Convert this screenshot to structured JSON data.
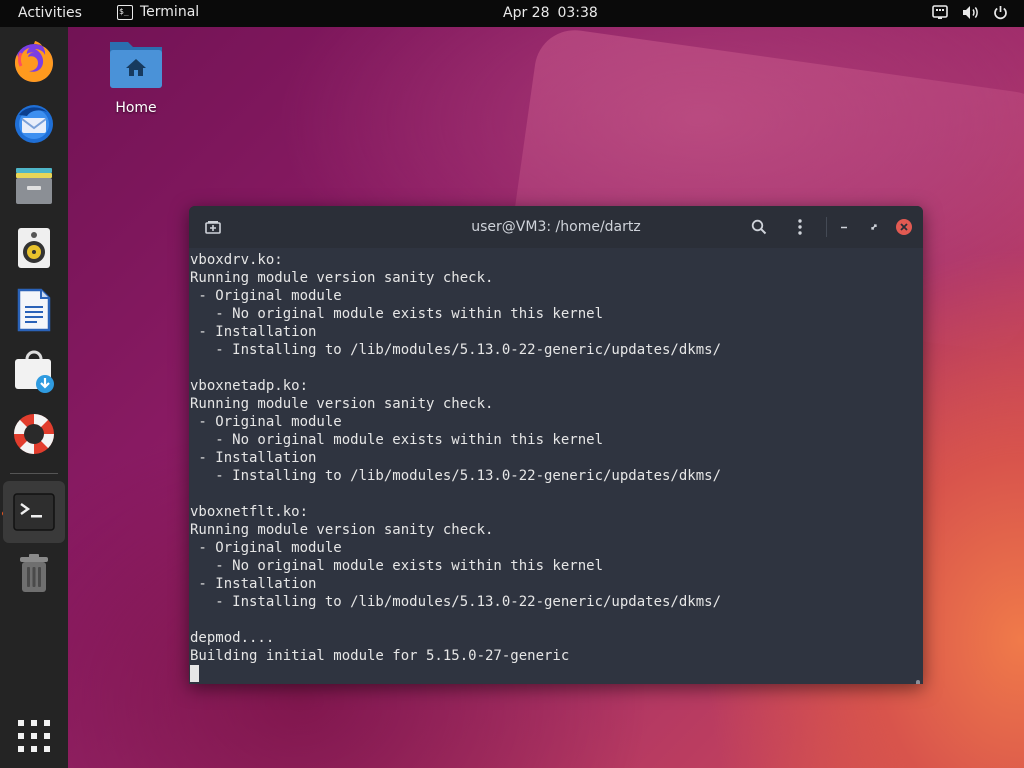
{
  "topbar": {
    "activities": "Activities",
    "app_name": "Terminal",
    "app_icon_glyph": "$_",
    "date": "Apr 28",
    "time": "03:38",
    "tray_icons": [
      "network-icon",
      "volume-icon",
      "power-icon"
    ]
  },
  "desktop": {
    "home_label": "Home"
  },
  "dock": {
    "items": [
      "firefox-icon",
      "thunderbird-icon",
      "files-icon",
      "rhythmbox-icon",
      "writer-icon",
      "software-icon",
      "help-icon",
      "terminal-icon",
      "trash-icon"
    ],
    "show_apps": "apps-grid-icon"
  },
  "terminal": {
    "title": "user@VM3: /home/dartz",
    "lines": [
      "vboxdrv.ko:",
      "Running module version sanity check.",
      " - Original module",
      "   - No original module exists within this kernel",
      " - Installation",
      "   - Installing to /lib/modules/5.13.0-22-generic/updates/dkms/",
      "",
      "vboxnetadp.ko:",
      "Running module version sanity check.",
      " - Original module",
      "   - No original module exists within this kernel",
      " - Installation",
      "   - Installing to /lib/modules/5.13.0-22-generic/updates/dkms/",
      "",
      "vboxnetflt.ko:",
      "Running module version sanity check.",
      " - Original module",
      "   - No original module exists within this kernel",
      " - Installation",
      "   - Installing to /lib/modules/5.13.0-22-generic/updates/dkms/",
      "",
      "depmod....",
      "Building initial module for 5.15.0-27-generic"
    ]
  },
  "colors": {
    "accent": "#e95420",
    "terminal_bg": "#2f3440",
    "topbar_bg": "#0a0a0a",
    "dock_bg": "#242424"
  }
}
